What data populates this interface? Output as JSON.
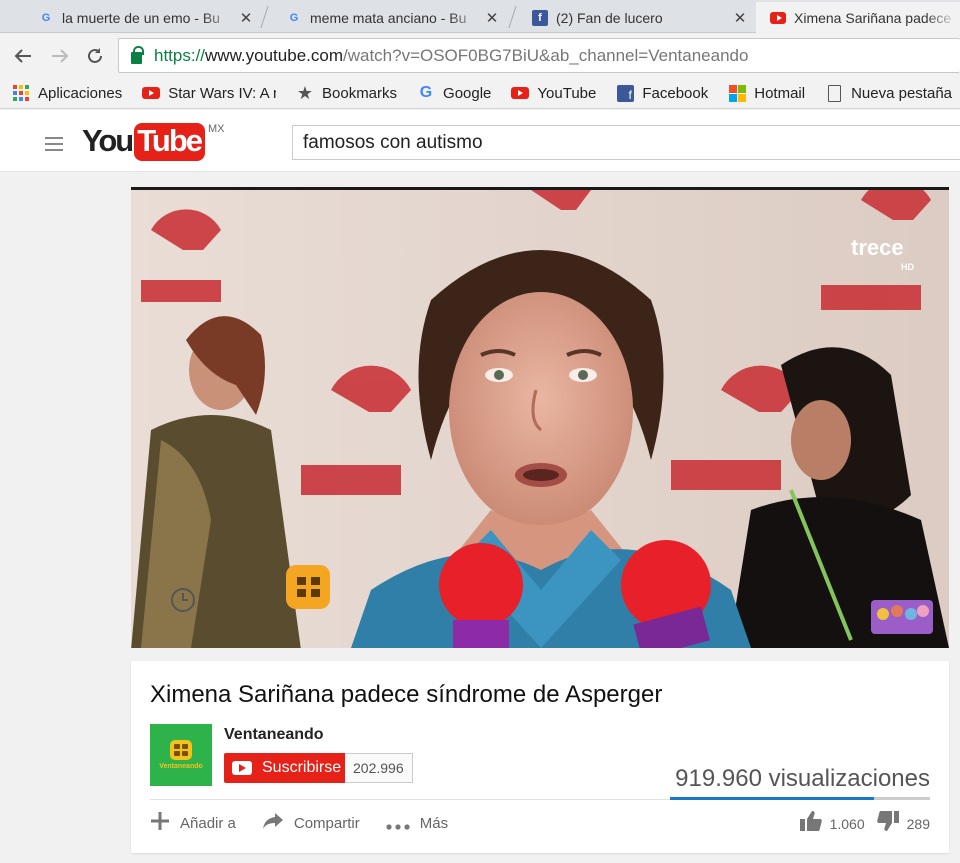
{
  "browser": {
    "tabs": [
      {
        "title": "la muerte de un emo - Bu",
        "icon": "google-g-icon"
      },
      {
        "title": "meme mata anciano - Bu",
        "icon": "google-g-icon"
      },
      {
        "title": "(2) Fan de lucero",
        "icon": "facebook-icon"
      },
      {
        "title": "Ximena Sariñana padece",
        "icon": "youtube-icon",
        "active": true
      }
    ],
    "url": {
      "scheme": "https://",
      "host": "www.youtube.com",
      "path": "/watch?v=OSOF0BG7BiU&ab_channel=Ventaneando"
    },
    "bookmarks": [
      {
        "label": "Aplicaciones",
        "icon": "apps-icon"
      },
      {
        "label": "Star Wars IV: A new h",
        "icon": "youtube-icon"
      },
      {
        "label": "Bookmarks",
        "icon": "star-icon"
      },
      {
        "label": "Google",
        "icon": "google-g-icon"
      },
      {
        "label": "YouTube",
        "icon": "youtube-icon"
      },
      {
        "label": "Facebook",
        "icon": "facebook-icon"
      },
      {
        "label": "Hotmail",
        "icon": "microsoft-icon"
      },
      {
        "label": "Nueva pestaña",
        "icon": "page-icon"
      }
    ]
  },
  "youtube": {
    "logo": {
      "you": "You",
      "tube": "Tube",
      "region": "MX"
    },
    "search_value": "famosos con autismo",
    "player": {
      "watermark": "trece",
      "watermark_sub": "HD"
    },
    "video": {
      "title": "Ximena Sariñana padece síndrome de Asperger",
      "channel": "Ventaneando",
      "channel_thumb_label": "Ventaneando",
      "subscribe_label": "Suscribirse",
      "subscriber_count": "202.996",
      "views": "919.960 visualizaciones",
      "like_ratio": 0.786,
      "actions": {
        "add": "Añadir a",
        "share": "Compartir",
        "more": "Más"
      },
      "likes": "1.060",
      "dislikes": "289"
    }
  },
  "colors": {
    "youtube_red": "#e62117",
    "link_green": "#0b8043",
    "ratio_blue": "#167ac6"
  }
}
